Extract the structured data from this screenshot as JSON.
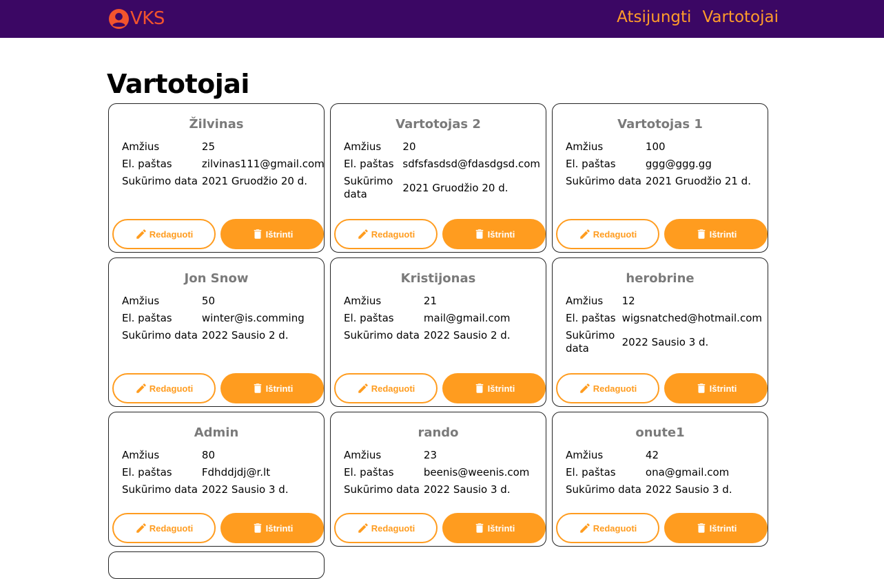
{
  "nav": {
    "brand": "VKS",
    "links": [
      "Atsijungti",
      "Vartotojai"
    ]
  },
  "page": {
    "title": "Vartotojai"
  },
  "labels": {
    "age": "Amžius",
    "email": "El. paštas",
    "created": "Sukūrimo data",
    "edit": "Redaguoti",
    "delete": "Ištrinti"
  },
  "colors": {
    "navbar": "#3b0764",
    "brand": "#f2542d",
    "accent": "#ff9c1f"
  },
  "users": [
    {
      "name": "Žilvinas",
      "age": "25",
      "email": "zilvinas111@gmail.com",
      "created": "2021 Gruodžio 20 d."
    },
    {
      "name": "Vartotojas 2",
      "age": "20",
      "email": "sdfsfasdsd@fdasdgsd.com",
      "created": "2021 Gruodžio 20 d."
    },
    {
      "name": "Vartotojas 1",
      "age": "100",
      "email": "ggg@ggg.gg",
      "created": "2021 Gruodžio 21 d."
    },
    {
      "name": "Jon Snow",
      "age": "50",
      "email": "winter@is.comming",
      "created": "2022 Sausio 2 d."
    },
    {
      "name": "Kristijonas",
      "age": "21",
      "email": "mail@gmail.com",
      "created": "2022 Sausio 2 d."
    },
    {
      "name": "herobrine",
      "age": "12",
      "email": "wigsnatched@hotmail.com",
      "created": "2022 Sausio 3 d."
    },
    {
      "name": "Admin",
      "age": "80",
      "email": "Fdhddjdj@r.lt",
      "created": "2022 Sausio 3 d."
    },
    {
      "name": "rando",
      "age": "23",
      "email": "beenis@weenis.com",
      "created": "2022 Sausio 3 d."
    },
    {
      "name": "onute1",
      "age": "42",
      "email": "ona@gmail.com",
      "created": "2022 Sausio 3 d."
    }
  ],
  "icons": {
    "brand": "user-circle-icon",
    "edit": "pencil-icon",
    "delete": "trash-icon"
  }
}
